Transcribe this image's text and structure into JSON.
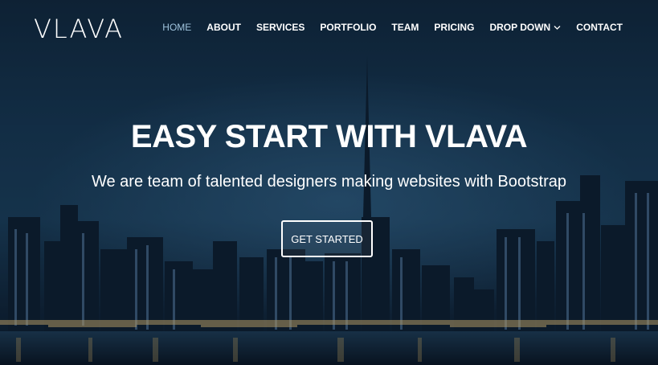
{
  "header": {
    "logo": "VLAVA",
    "nav": [
      {
        "label": "HOME",
        "active": true
      },
      {
        "label": "ABOUT"
      },
      {
        "label": "SERVICES"
      },
      {
        "label": "PORTFOLIO"
      },
      {
        "label": "TEAM"
      },
      {
        "label": "PRICING"
      },
      {
        "label": "DROP DOWN",
        "icon": "chevron-down-icon"
      },
      {
        "label": "CONTACT"
      }
    ]
  },
  "hero": {
    "title": "EASY START WITH VLAVA",
    "subtitle": "We are team of talented designers making websites with Bootstrap",
    "cta_label": "GET STARTED",
    "background": "city-skyline-night-image"
  },
  "colors": {
    "nav_active": "#9fc3dc",
    "text": "#ffffff",
    "sky": "#163650"
  }
}
